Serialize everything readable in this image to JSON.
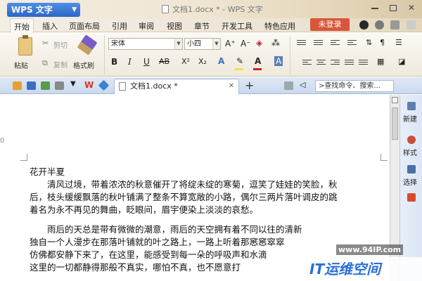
{
  "app": {
    "name": "WPS 文字",
    "doc_title": "文档1.docx * - WPS 文字"
  },
  "menu": {
    "items": [
      "开始",
      "插入",
      "页面布局",
      "引用",
      "审阅",
      "视图",
      "章节",
      "开发工具",
      "特色应用"
    ],
    "login": "未登录"
  },
  "ribbon": {
    "paste": "粘贴",
    "cut": "剪切",
    "copy": "复制",
    "format_painter": "格式刷",
    "font_name": "宋体",
    "font_size": "小四",
    "bold": "B",
    "italic": "I",
    "underline": "U",
    "strike": "AB",
    "superscript": "X²",
    "subscript": "X₂",
    "grow_font": "A⁺",
    "shrink_font": "A⁻",
    "font_color_hex": "#d42020",
    "highlight_hex": "#f4e23a"
  },
  "tabs": {
    "document": "文档1.docx *",
    "add": "+",
    "close": "✕"
  },
  "search": {
    "placeholder": ">查找命令、搜索..."
  },
  "sidepanel": {
    "items": [
      "新建",
      "样式",
      "选择"
    ]
  },
  "document": {
    "title": "花开半夏",
    "paragraphs": [
      [
        "清风过境，带着浓浓的秋意催开了将绽未绽的寒菊，逗笑了娃娃的笑脸，秋",
        "后，枝头缓缓飘落的秋叶铺满了整条不算宽敞的小路，偶尔三两片落叶调皮的跳",
        "着名为永不再见的舞曲，眨眼间，眉宇便染上淡淡的哀愁。"
      ],
      [
        "雨后的天总是带有微微的潮意，雨后的天空拥有着不同以往的清新",
        "独自一个人漫步在那落叶铺就的叶之路上，一路上听着那窸窸窣窣",
        "仿佛都安静下来了，在这里，能感受到每一朵的呼吸声和水滴",
        "这里的一切都静得那般不真实，哪怕不真，也不愿意打"
      ]
    ]
  },
  "watermark": {
    "url": "www.94IP.com",
    "brand": "IT运维空间"
  }
}
